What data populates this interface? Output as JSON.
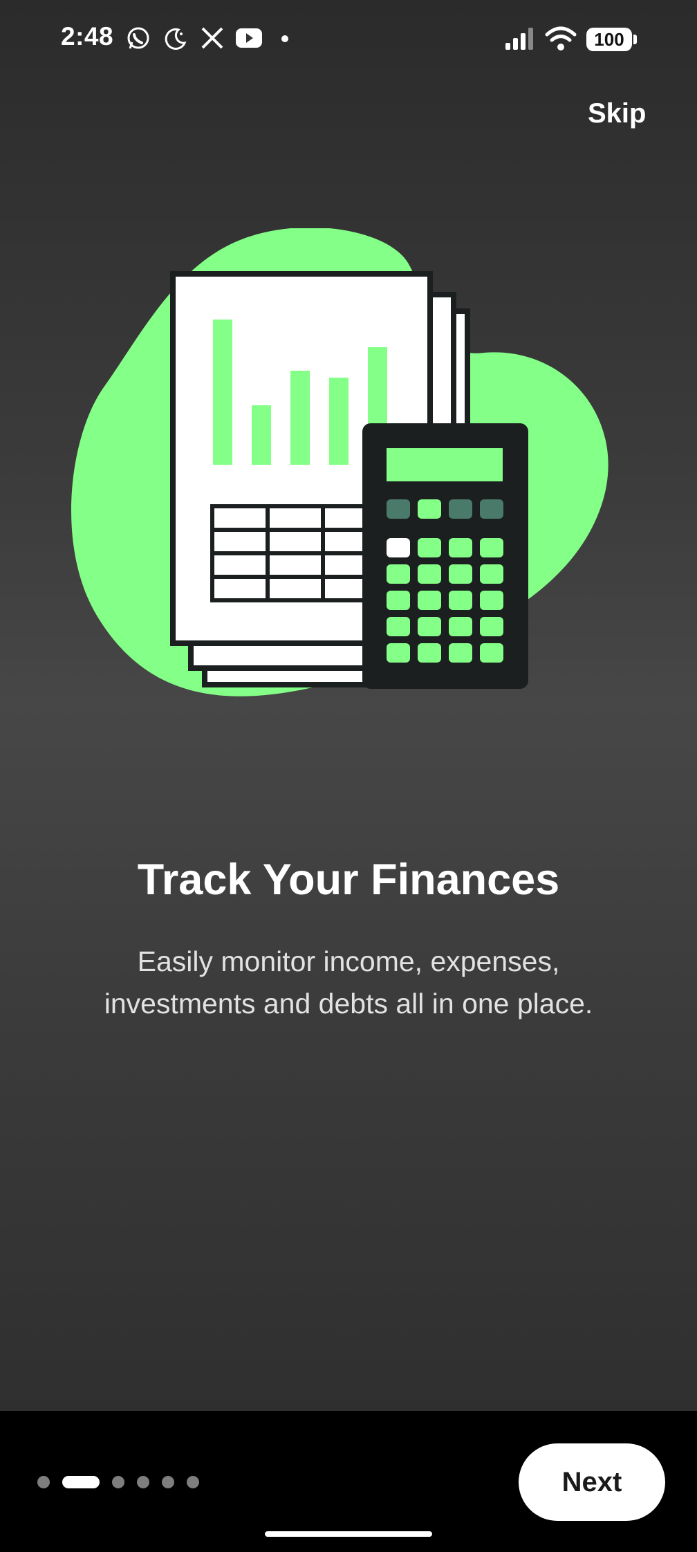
{
  "status_bar": {
    "time": "2:48",
    "battery": "100",
    "notification_icons": [
      "whatsapp-icon",
      "moon-icon",
      "x-icon",
      "youtube-icon",
      "dot-icon"
    ],
    "system_icons": [
      "signal-icon",
      "wifi-icon",
      "battery-icon"
    ]
  },
  "header": {
    "skip_label": "Skip"
  },
  "onboarding": {
    "illustration": "finance-documents-calculator-illustration",
    "title": "Track Your Finances",
    "subtitle_line1": "Easily monitor income, expenses,",
    "subtitle_line2": "investments and debts all in one place."
  },
  "pager": {
    "total": 6,
    "current": 2
  },
  "footer": {
    "next_label": "Next"
  },
  "colors": {
    "accent": "#84FF87",
    "background": "#3c3c3c",
    "dark": "#1b1f1f"
  }
}
